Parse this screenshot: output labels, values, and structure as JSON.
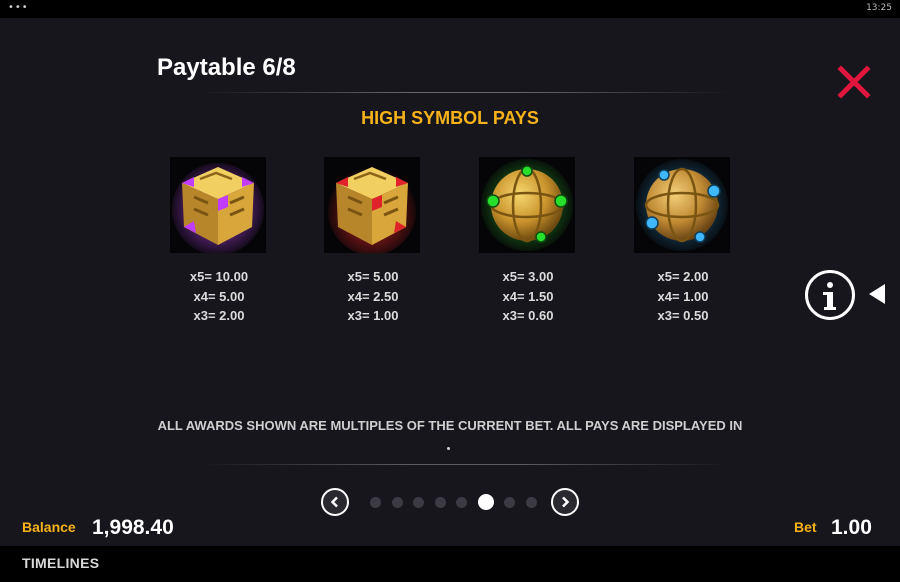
{
  "status": {
    "time": "13:25",
    "menu_glyph": "•••"
  },
  "header": {
    "title": "Paytable 6/8"
  },
  "section": {
    "heading": "HIGH SYMBOL PAYS"
  },
  "symbols": [
    {
      "icon": "purple-golden-cube-symbol",
      "pays": [
        "x5= 10.00",
        "x4= 5.00",
        "x3= 2.00"
      ]
    },
    {
      "icon": "red-golden-cube-symbol",
      "pays": [
        "x5= 5.00",
        "x4= 2.50",
        "x3= 1.00"
      ]
    },
    {
      "icon": "green-golden-sphere-symbol",
      "pays": [
        "x5= 3.00",
        "x4= 1.50",
        "x3= 0.60"
      ]
    },
    {
      "icon": "blue-golden-sphere-symbol",
      "pays": [
        "x5= 2.00",
        "x4= 1.00",
        "x3= 0.50"
      ]
    }
  ],
  "disclaimer": "ALL AWARDS SHOWN ARE MULTIPLES OF THE CURRENT BET. ALL PAYS ARE DISPLAYED IN",
  "pagination": {
    "total": 8,
    "current": 6
  },
  "footer": {
    "balance_label": "Balance",
    "balance_value": "1,998.40",
    "bet_label": "Bet",
    "bet_value": "1.00",
    "brand": "TIMELINES"
  },
  "colors": {
    "accent": "#f6b21a",
    "close": "#e0163e",
    "panel_bg": "#17161d"
  }
}
